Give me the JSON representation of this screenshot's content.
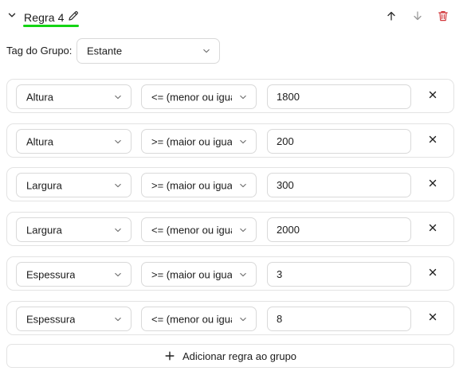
{
  "rule": {
    "title": "Regra 4",
    "collapse_icon": "chevron-down-icon",
    "edit_icon": "pencil-icon",
    "move_up_icon": "arrow-up-icon",
    "move_down_icon": "arrow-down-icon",
    "delete_icon": "trash-icon",
    "accent_color": "#14d414",
    "delete_color": "#d13438"
  },
  "group_tag": {
    "label": "Tag do Grupo:",
    "value": "Estante"
  },
  "conditions": [
    {
      "field": "Altura",
      "operator": "<= (menor ou igual)",
      "value": "1800"
    },
    {
      "field": "Altura",
      "operator": ">= (maior ou igual)",
      "value": "200"
    },
    {
      "field": "Largura",
      "operator": ">= (maior ou igual)",
      "value": "300"
    },
    {
      "field": "Largura",
      "operator": "<= (menor ou igual)",
      "value": "2000"
    },
    {
      "field": "Espessura",
      "operator": ">= (maior ou igual)",
      "value": "3"
    },
    {
      "field": "Espessura",
      "operator": "<= (menor ou igual)",
      "value": "8"
    }
  ],
  "add_rule": {
    "label": "Adicionar regra ao grupo",
    "icon": "plus-icon"
  }
}
